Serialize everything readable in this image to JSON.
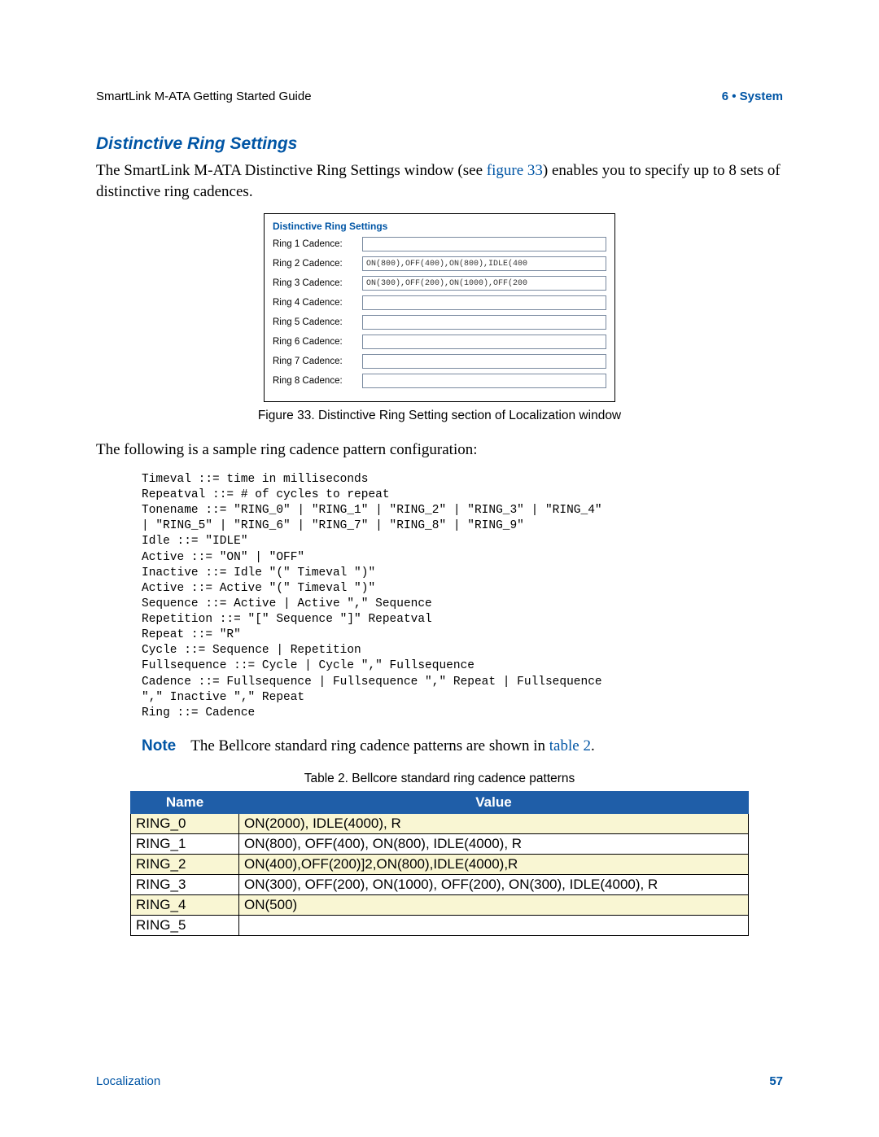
{
  "header": {
    "left": "SmartLink M-ATA Getting Started Guide",
    "right": "6 • System"
  },
  "section": {
    "title": "Distinctive Ring Settings",
    "intro_part1": "The SmartLink M-ATA Distinctive Ring Settings window (see ",
    "intro_link": "figure 33",
    "intro_part2": ") enables you to specify up to 8 sets of distinctive ring cadences."
  },
  "shot": {
    "title": "Distinctive Ring Settings",
    "rows": [
      {
        "label": "Ring 1 Cadence:",
        "value": ""
      },
      {
        "label": "Ring 2 Cadence:",
        "value": "ON(800),OFF(400),ON(800),IDLE(400"
      },
      {
        "label": "Ring 3 Cadence:",
        "value": "ON(300),OFF(200),ON(1000),OFF(200"
      },
      {
        "label": "Ring 4 Cadence:",
        "value": ""
      },
      {
        "label": "Ring 5 Cadence:",
        "value": ""
      },
      {
        "label": "Ring 6 Cadence:",
        "value": ""
      },
      {
        "label": "Ring 7 Cadence:",
        "value": ""
      },
      {
        "label": "Ring 8 Cadence:",
        "value": ""
      }
    ]
  },
  "fig_caption": "Figure 33. Distinctive Ring Setting section of Localization window",
  "para_following": "The following is a sample ring cadence pattern configuration:",
  "code_lines": [
    "Timeval ::= time in milliseconds",
    "Repeatval ::= # of cycles to repeat",
    "Tonename ::= \"RING_0\" | \"RING_1\" | \"RING_2\" | \"RING_3\" | \"RING_4\"",
    "| \"RING_5\" | \"RING_6\" | \"RING_7\" | \"RING_8\" | \"RING_9\"",
    "Idle ::= \"IDLE\"",
    "Active ::= \"ON\" | \"OFF\"",
    "Inactive ::= Idle \"(\" Timeval \")\"",
    "Active ::= Active \"(\" Timeval \")\"",
    "Sequence ::= Active | Active \",\" Sequence",
    "Repetition ::= \"[\" Sequence \"]\" Repeatval",
    "Repeat ::= \"R\"",
    "Cycle ::= Sequence | Repetition",
    "Fullsequence ::= Cycle | Cycle \",\" Fullsequence",
    "Cadence ::= Fullsequence | Fullsequence \",\" Repeat | Fullsequence",
    "\",\" Inactive \",\" Repeat",
    "Ring ::= Cadence"
  ],
  "note": {
    "label": "Note",
    "text_part1": "The Bellcore standard ring cadence patterns are shown in ",
    "link": "table 2",
    "text_part2": "."
  },
  "table": {
    "caption": "Table 2. Bellcore standard ring cadence patterns",
    "headers": {
      "name": "Name",
      "value": "Value"
    },
    "rows": [
      {
        "name": "RING_0",
        "value": "ON(2000), IDLE(4000), R"
      },
      {
        "name": "RING_1",
        "value": "ON(800), OFF(400), ON(800), IDLE(4000), R"
      },
      {
        "name": "RING_2",
        "value": "ON(400),OFF(200)]2,ON(800),IDLE(4000),R"
      },
      {
        "name": "RING_3",
        "value": "ON(300), OFF(200), ON(1000), OFF(200), ON(300), IDLE(4000), R"
      },
      {
        "name": "RING_4",
        "value": "ON(500)"
      },
      {
        "name": "RING_5",
        "value": ""
      }
    ]
  },
  "footer": {
    "left": "Localization",
    "right": "57"
  }
}
